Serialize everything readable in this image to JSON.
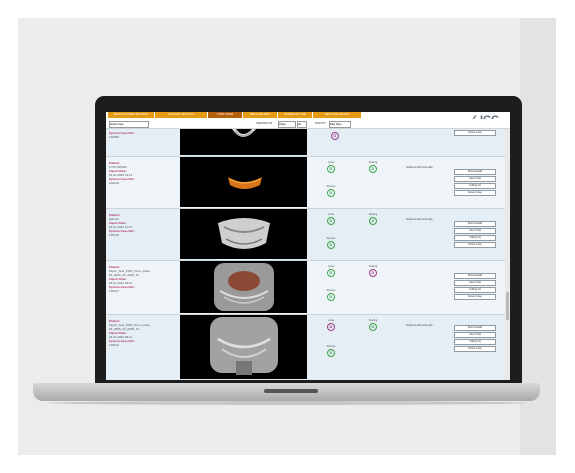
{
  "nav": {
    "tabs": [
      {
        "label": "ENGLISH OWNER SETTINGS"
      },
      {
        "label": "ACCOUNT SETTINGS"
      },
      {
        "label": "YOUR CASES"
      },
      {
        "label": "NEW CASE DATA"
      },
      {
        "label": "SHARED WITH ME"
      },
      {
        "label": "NEW CASE UPLOAD"
      }
    ],
    "logo_text": "ICC"
  },
  "filter": {
    "search_value": "Select Case",
    "created_label": "CREATED ON",
    "created_from": "Today",
    "created_to": "All",
    "sort_label": "SORT BY",
    "sort_value": "Date Desc"
  },
  "cases": [
    {
      "patient_label": "System Case Ref.:",
      "patient_value": "100050",
      "local_label": "",
      "remote_label": "",
      "shared_text": "",
      "buttons": [
        "Delete Case"
      ]
    },
    {
      "patient_label": "Patient:",
      "patient_value": "CTD7196022",
      "import_label": "Import Date:",
      "import_value": "04.01.2022 13:14",
      "ref_label": "System Case Ref.:",
      "ref_value": "100136",
      "local_label": "Local",
      "sharing_label": "Sharing",
      "remote_label": "Remote",
      "shared_text": "Shared with Friends",
      "buttons": [
        "Show Details",
        "Case Chat",
        "Calling (0)",
        "Delete Case"
      ]
    },
    {
      "patient_label": "Patient:",
      "patient_value": "jalkin11",
      "import_label": "Import Date:",
      "import_value": "04.01.2022 11:27",
      "ref_label": "System Case Ref.:",
      "ref_value": "100125",
      "local_label": "Local",
      "sharing_label": "Sharing",
      "remote_label": "Remote",
      "shared_text": "Shared with Friends",
      "buttons": [
        "Show Details",
        "Case Chat",
        "Calling (0)",
        "Delete Case"
      ]
    },
    {
      "patient_label": "Patient:",
      "patient_value": "Taylor_Test_PWP_Prem_Date-03_0905_03_0905_13",
      "import_label": "Import Date:",
      "import_value": "04.01.2022 09:11",
      "ref_label": "System Case Ref.:",
      "ref_value": "100117",
      "local_label": "Local",
      "sharing_label": "Sharing",
      "remote_label": "Remote",
      "shared_text": "",
      "buttons": [
        "Show Details",
        "Case Chat",
        "Calling (0)",
        "Delete Case"
      ]
    },
    {
      "patient_label": "Patient:",
      "patient_value": "Taylor_Test_PWP_Prem_Date-03_0905_03_0905_13",
      "import_label": "Import Date:",
      "import_value": "04.01.2022 09:11",
      "ref_label": "System Case Ref.:",
      "ref_value": "100114",
      "local_label": "Local",
      "sharing_label": "Sharing",
      "remote_label": "Remote",
      "shared_text": "Shared with Friends",
      "buttons": [
        "Show Details",
        "Case Chat",
        "Calling (0)",
        "Delete Case"
      ]
    }
  ],
  "colors": {
    "tab_orange": "#e59a12",
    "tab_active": "#b55f0a",
    "patient_heading": "#b0306a",
    "status_green": "#3aa04a",
    "status_purple": "#a03a8a"
  }
}
